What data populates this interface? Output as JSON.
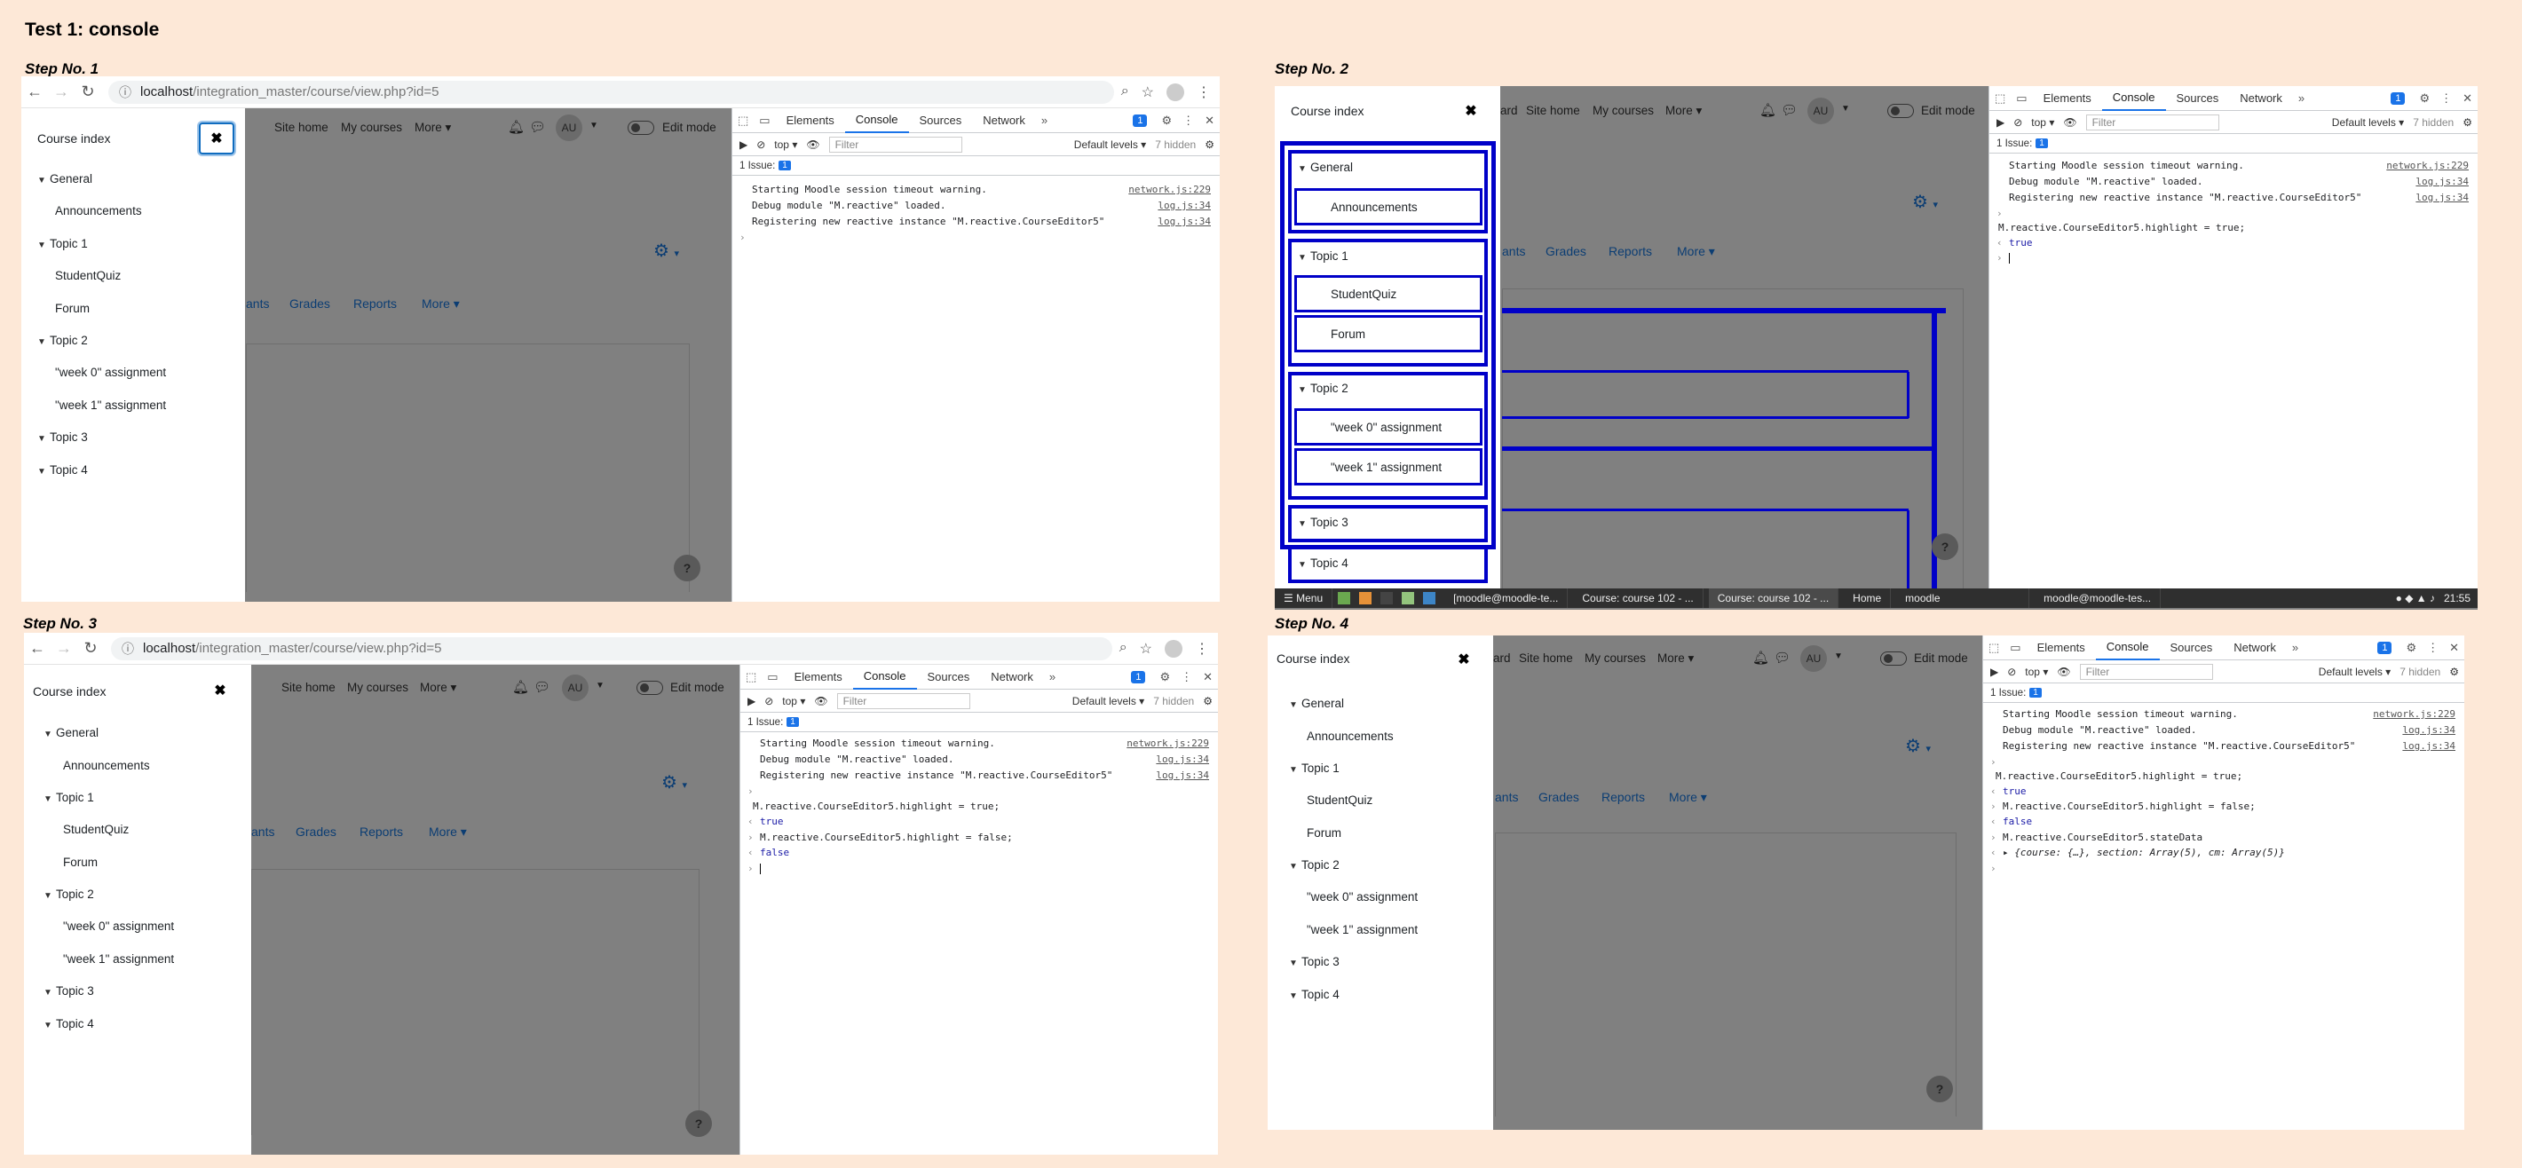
{
  "page_title": "Test 1: console",
  "steps": [
    "Step No. 1",
    "Step No. 2",
    "Step No. 3",
    "Step No. 4"
  ],
  "browser": {
    "url_host": "localhost",
    "url_path": "/integration_master/course/view.php?id=5"
  },
  "moodle": {
    "nav_partial": "ard",
    "site_home": "Site home",
    "my_courses": "My courses",
    "more": "More",
    "avatar_initials": "AU",
    "edit_mode": "Edit mode",
    "tab_partial": "ants",
    "grades": "Grades",
    "reports": "Reports",
    "help": "?"
  },
  "course_index": {
    "title": "Course index",
    "close": "✖",
    "sections": [
      {
        "label": "General",
        "items": [
          "Announcements"
        ]
      },
      {
        "label": "Topic 1",
        "items": [
          "StudentQuiz",
          "Forum"
        ]
      },
      {
        "label": "Topic 2",
        "items": [
          "\"week 0\" assignment",
          "\"week 1\" assignment"
        ]
      },
      {
        "label": "Topic 3",
        "items": []
      },
      {
        "label": "Topic 4",
        "items": []
      }
    ]
  },
  "devtools": {
    "tabs": [
      "Elements",
      "Console",
      "Sources",
      "Network"
    ],
    "more_tabs": "»",
    "issue_badge": "1",
    "context": "top",
    "filter_placeholder": "Filter",
    "levels": "Default levels",
    "hidden": "7 hidden",
    "issues_label": "1 Issue:",
    "issues_count": "1",
    "logs": [
      {
        "msg": "Starting Moodle session timeout warning.",
        "src": "network.js:229"
      },
      {
        "msg": "Debug module \"M.reactive\" loaded.",
        "src": "log.js:34"
      },
      {
        "msg": "Registering new reactive instance \"M.reactive.CourseEditor5\"",
        "src": "log.js:34"
      }
    ],
    "cmd_highlight_true": "M.reactive.CourseEditor5.highlight = true;",
    "cmd_highlight_false": "M.reactive.CourseEditor5.highlight = false;",
    "result_true": "true",
    "result_false": "false",
    "cmd_state": "M.reactive.CourseEditor5.stateData",
    "state_result": "{course: {…}, section: Array(5), cm: Array(5)}",
    "prompt": "›",
    "out_arrow": "‹"
  },
  "taskbar": {
    "menu": "Menu",
    "items": [
      "[moodle@moodle-te...",
      "Course: course 102 - ...",
      "Course: course 102 - ...",
      "Home",
      "moodle",
      "moodle@moodle-tes..."
    ],
    "time": "21:55"
  }
}
